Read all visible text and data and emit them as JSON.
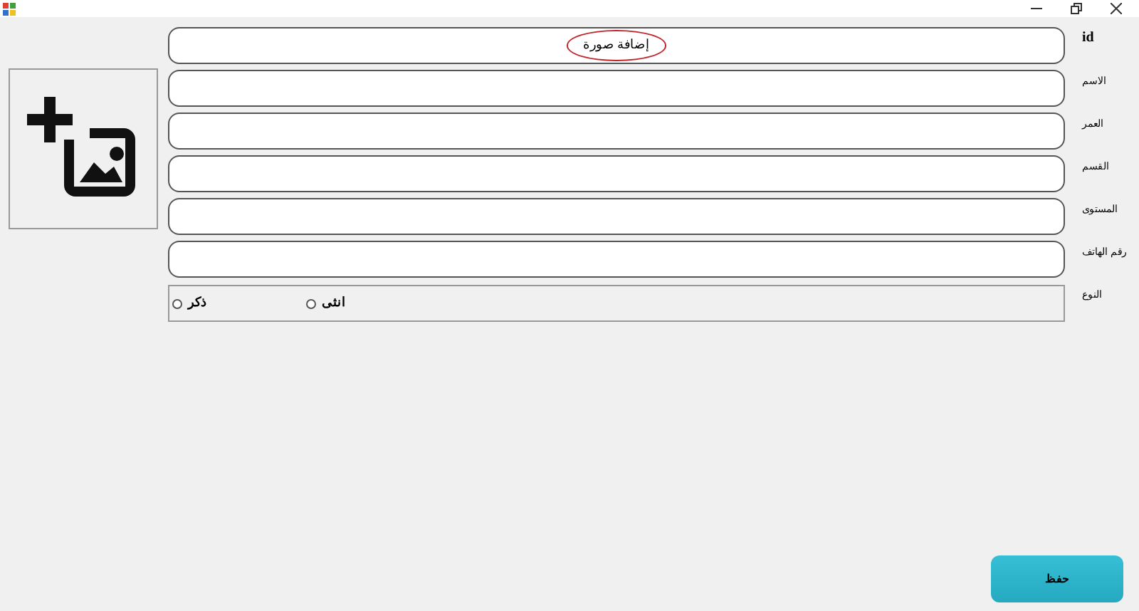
{
  "fields": [
    {
      "label": "id",
      "value": "إضافة صورة",
      "annotated": true
    },
    {
      "label": "الاسم",
      "annotated": false
    },
    {
      "label": "العمر",
      "annotated": false
    },
    {
      "label": "القسم",
      "annotated": false
    },
    {
      "label": "المستوى",
      "annotated": false
    },
    {
      "label": "رقم الهاتف",
      "annotated": false
    }
  ],
  "gender": {
    "label": "النوع",
    "options": [
      {
        "label": "انثى",
        "selected": false
      },
      {
        "label": "ذكر",
        "selected": false
      }
    ]
  },
  "save_button": "حفظ"
}
